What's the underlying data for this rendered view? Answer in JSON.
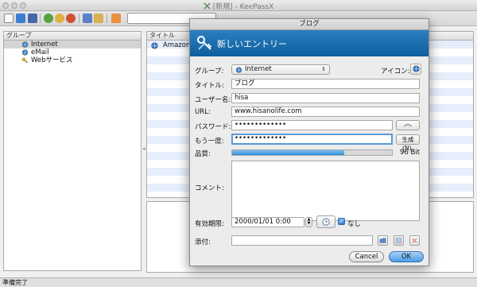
{
  "window": {
    "title": "[新規] - KeePassX"
  },
  "groups": {
    "header": "グループ",
    "items": [
      {
        "label": "Internet",
        "icon": "globe-icon"
      },
      {
        "label": "eMail",
        "icon": "globe-icon"
      },
      {
        "label": "Webサービス",
        "icon": "key-icon"
      }
    ]
  },
  "entries": {
    "header": "タイトル",
    "rows": [
      {
        "title": "Amazon"
      }
    ]
  },
  "status": "準備完了",
  "dialog": {
    "window_title": "ブログ",
    "banner_title": "新しいエントリー",
    "group_label": "グループ:",
    "group_value": "Internet",
    "icon_label": "アイコン:",
    "title_label": "タイトル:",
    "title_value": "ブログ",
    "username_label": "ユーザー名:",
    "username_value": "hisa",
    "url_label": "URL:",
    "url_value": "www.hisanolife.com",
    "password_label": "パスワード:",
    "password_value": "•••••••••••••",
    "repeat_label": "もう一度:",
    "repeat_value": "•••••••••••••",
    "generate_label": "生成(N).",
    "quality_label": "品質:",
    "quality_fraction": 0.7,
    "quality_text": "96 Bit",
    "comment_label": "コメント:",
    "expires_label": "有効期限:",
    "expires_value": "2000/01/01 0:00",
    "never_label": "なし",
    "attachment_label": "添付:",
    "cancel_label": "Cancel",
    "ok_label": "OK"
  },
  "colors": {
    "banner": "#1a6fb0",
    "accent": "#4a9be6",
    "stripe": "#e6eefb"
  }
}
